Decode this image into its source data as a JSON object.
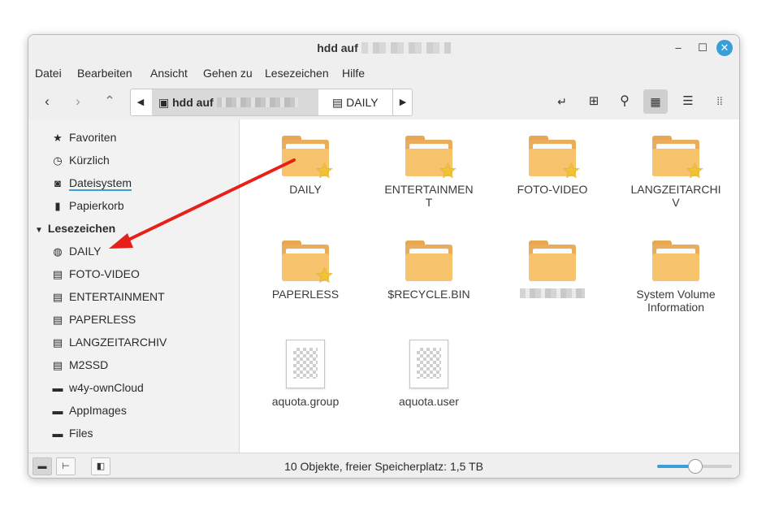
{
  "window": {
    "title": "hdd auf"
  },
  "menu": [
    "Datei",
    "Bearbeiten",
    "Ansicht",
    "Gehen zu",
    "Lesezeichen",
    "Hilfe"
  ],
  "pathbar": {
    "segments": [
      "hdd auf",
      "DAILY"
    ]
  },
  "sidebar": {
    "places": [
      {
        "label": "Favoriten",
        "icon": "star-icon"
      },
      {
        "label": "Kürzlich",
        "icon": "clock-icon"
      },
      {
        "label": "Dateisystem",
        "icon": "drive-icon"
      },
      {
        "label": "Papierkorb",
        "icon": "trash-icon"
      }
    ],
    "bookmarks_heading": "Lesezeichen",
    "bookmarks": [
      {
        "label": "DAILY",
        "icon": "globe-icon"
      },
      {
        "label": "FOTO-VIDEO",
        "icon": "folder-network-icon"
      },
      {
        "label": "ENTERTAINMENT",
        "icon": "folder-network-icon"
      },
      {
        "label": "PAPERLESS",
        "icon": "folder-network-icon"
      },
      {
        "label": "LANGZEITARCHIV",
        "icon": "folder-network-icon"
      },
      {
        "label": "M2SSD",
        "icon": "folder-network-icon"
      },
      {
        "label": "w4y-ownCloud",
        "icon": "folder-icon"
      },
      {
        "label": "AppImages",
        "icon": "folder-icon"
      },
      {
        "label": "Files",
        "icon": "folder-icon"
      }
    ]
  },
  "files": [
    {
      "name": "DAILY",
      "type": "folder",
      "starred": true
    },
    {
      "name": "ENTERTAINMEN\nT",
      "type": "folder",
      "starred": true
    },
    {
      "name": "FOTO-VIDEO",
      "type": "folder",
      "starred": true
    },
    {
      "name": "LANGZEITARCHI\nV",
      "type": "folder",
      "starred": true
    },
    {
      "name": "PAPERLESS",
      "type": "folder",
      "starred": true
    },
    {
      "name": "$RECYCLE.BIN",
      "type": "folder",
      "starred": false
    },
    {
      "name": "",
      "type": "folder",
      "starred": false,
      "blurred": true
    },
    {
      "name": "System Volume\nInformation",
      "type": "folder",
      "starred": false
    },
    {
      "name": "aquota.group",
      "type": "file",
      "starred": false
    },
    {
      "name": "aquota.user",
      "type": "file",
      "starred": false
    }
  ],
  "status": {
    "text": "10 Objekte, freier Speicherplatz: 1,5 TB",
    "zoom_level": 0.5
  },
  "colors": {
    "accent": "#3a9fd9",
    "arrow": "#e8201a",
    "folder": "#f7c46d"
  }
}
